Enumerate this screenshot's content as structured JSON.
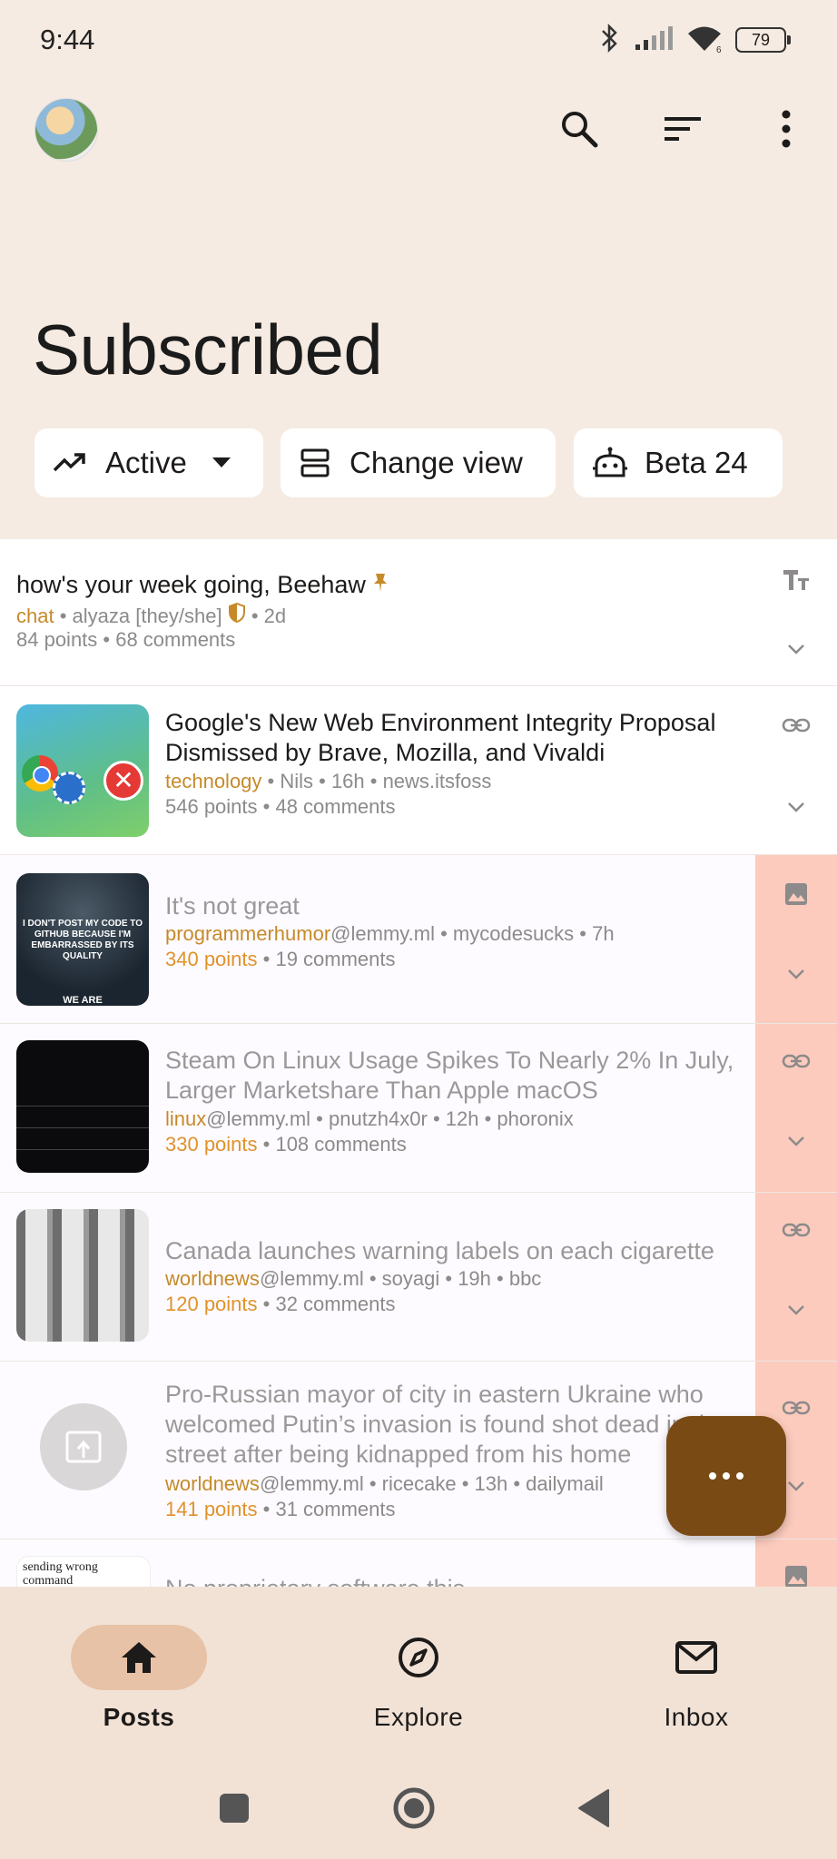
{
  "status": {
    "time": "9:44",
    "battery": "79"
  },
  "header": {
    "title": "Subscribed"
  },
  "chips": [
    {
      "label": "Active"
    },
    {
      "label": "Change view"
    },
    {
      "label": "Beta 24"
    }
  ],
  "posts": [
    {
      "title": "how's your week going, Beehaw",
      "community": "chat",
      "meta_rest": " • alyaza [they/she] ",
      "meta_time": " • 2d",
      "points": "84 points",
      "comments": " • 68 comments"
    },
    {
      "title": "Google's New Web Environment Integrity Proposal Dismissed by Brave, Mozilla, and Vivaldi",
      "community": "technology",
      "meta_rest": " • Nils • 16h • news.itsfoss",
      "points": "546 points",
      "comments": " • 48 comments"
    },
    {
      "title": "It's not great",
      "community": "programmerhumor",
      "instance": "@lemmy.ml",
      "meta_rest": " • mycodesucks • 7h",
      "points": "340 points",
      "comments": " • 19 comments",
      "thumb_text": "I DON'T POST MY CODE TO GITHUB BECAUSE I'M EMBARRASSED BY ITS QUALITY",
      "thumb_caption": "WE ARE"
    },
    {
      "title": "Steam On Linux Usage Spikes To Nearly 2% In July, Larger Marketshare Than Apple macOS",
      "community": "linux",
      "instance": "@lemmy.ml",
      "meta_rest": " • pnutzh4x0r • 12h • phoronix",
      "points": "330 points",
      "comments": " • 108 comments"
    },
    {
      "title": "Canada launches warning labels on each cigarette",
      "community": "worldnews",
      "instance": "@lemmy.ml",
      "meta_rest": " • soyagi • 19h • bbc",
      "points": "120 points",
      "comments": " • 32 comments"
    },
    {
      "title": "Pro-Russian mayor of city in eastern Ukraine who welcomed Putin’s invasion is found shot dead in the street after being kidnapped from his home",
      "community": "worldnews",
      "instance": "@lemmy.ml",
      "meta_rest": " • ricecake • 13h • dailymail",
      "points": "141 points",
      "comments": " • 31 comments"
    },
    {
      "title": "No proprietary software this...",
      "thumb_text": "sending wrong command"
    }
  ],
  "nav": [
    {
      "label": "Posts"
    },
    {
      "label": "Explore"
    },
    {
      "label": "Inbox"
    }
  ],
  "colors": {
    "accent": "#7a4a15",
    "community": "#c68a2a",
    "side_strip": "#fccbbd"
  }
}
